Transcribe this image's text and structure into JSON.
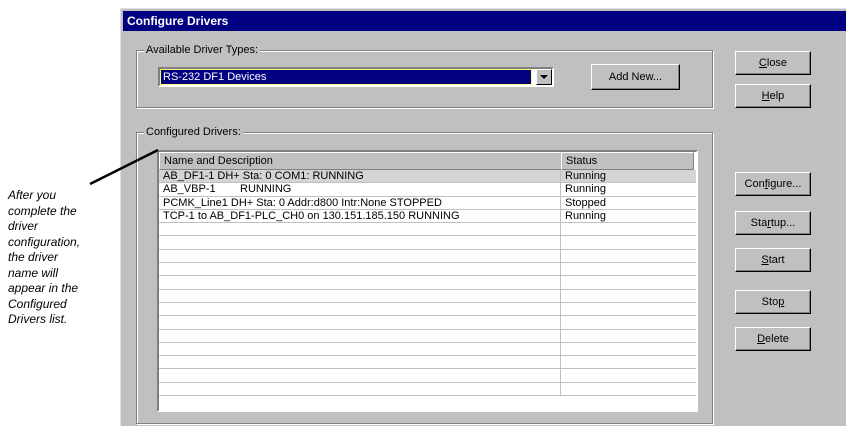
{
  "annotation": {
    "lines": [
      "After you",
      "complete the",
      "driver",
      "configuration,",
      "the driver",
      "name will",
      "appear in the",
      "Configured",
      "Drivers list."
    ]
  },
  "dialog": {
    "title": "Configure Drivers",
    "available_group": {
      "label": "Available Driver Types:",
      "selected_value": "RS-232 DF1 Devices",
      "add_new_label": "Add New..."
    },
    "configured_group": {
      "label": "Configured Drivers:",
      "columns": [
        "Name and Description",
        "Status"
      ],
      "rows": [
        {
          "name": "AB_DF1-1 DH+ Sta: 0 COM1: RUNNING",
          "status": "Running"
        },
        {
          "name": "AB_VBP-1        RUNNING",
          "status": "Running"
        },
        {
          "name": "PCMK_Line1 DH+ Sta: 0 Addr:d800 Intr:None STOPPED",
          "status": "Stopped"
        },
        {
          "name": "TCP-1 to AB_DF1-PLC_CH0 on 130.151.185.150 RUNNING",
          "status": "Running"
        }
      ]
    },
    "buttons": {
      "close": {
        "pre": "",
        "key": "C",
        "post": "lose"
      },
      "help": {
        "pre": "",
        "key": "H",
        "post": "elp"
      },
      "configure": {
        "pre": "Con",
        "key": "f",
        "post": "igure..."
      },
      "startup": {
        "pre": "Sta",
        "key": "r",
        "post": "tup..."
      },
      "start": {
        "pre": "",
        "key": "S",
        "post": "tart"
      },
      "stop": {
        "pre": "Sto",
        "key": "p",
        "post": ""
      },
      "delete": {
        "pre": "",
        "key": "D",
        "post": "elete"
      }
    }
  },
  "colors": {
    "titlebar": "#000080",
    "dialog_face": "#c0c0c0",
    "selection": "#000080"
  }
}
